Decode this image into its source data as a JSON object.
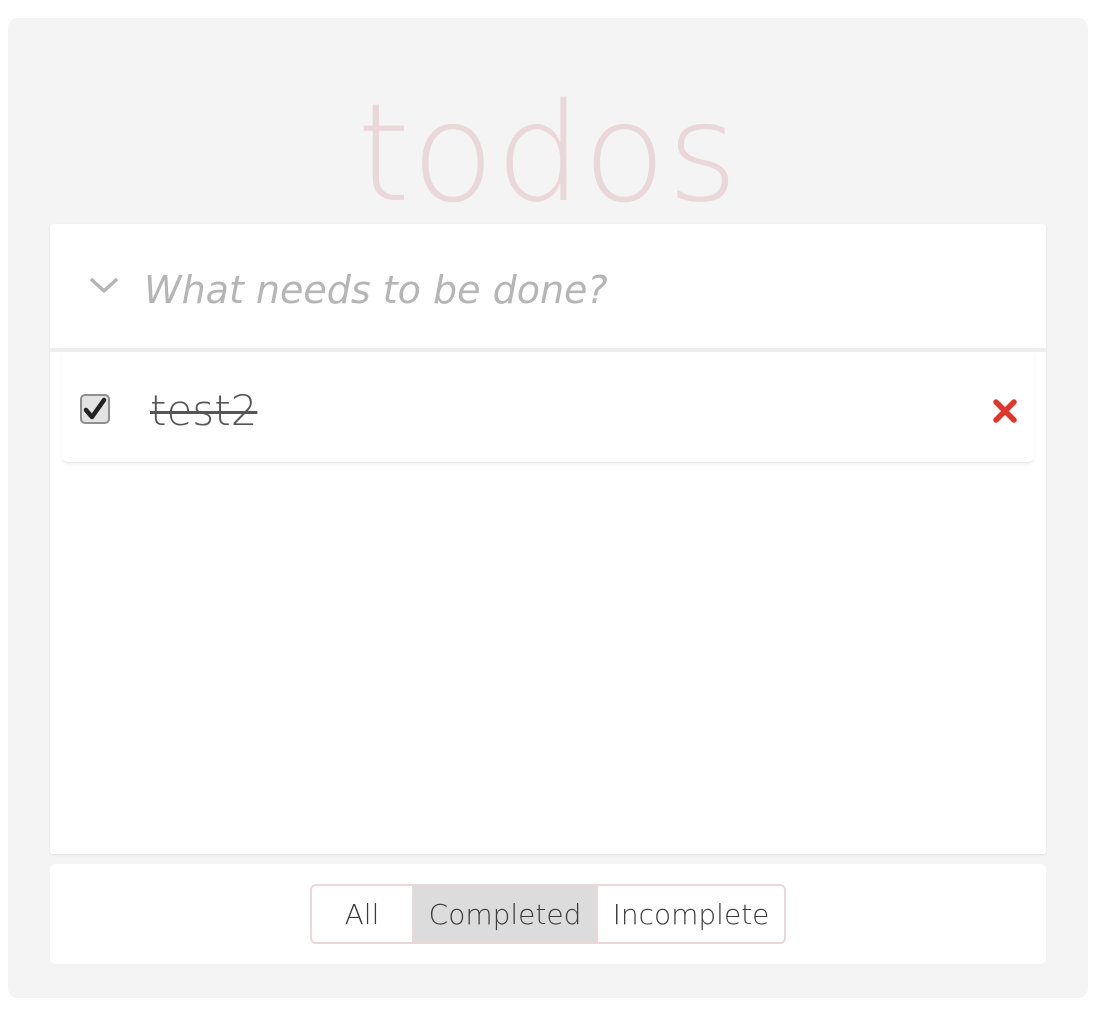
{
  "app": {
    "title": "todos"
  },
  "input": {
    "placeholder": "What needs to be done?",
    "value": "",
    "toggle_icon": "chevron-down-icon"
  },
  "todos": [
    {
      "label": "test2",
      "completed": true,
      "check_icon": "checkmark-icon",
      "delete_icon": "close-icon"
    }
  ],
  "filters": {
    "all_label": "All",
    "completed_label": "Completed",
    "incomplete_label": "Incomplete",
    "selected": "Completed"
  },
  "colors": {
    "title": "#ead7d9",
    "delete": "#e0352b",
    "selected_filter_bg": "#dcdcdc",
    "filter_border": "#ead7d9",
    "app_bg": "#f4f4f4"
  }
}
